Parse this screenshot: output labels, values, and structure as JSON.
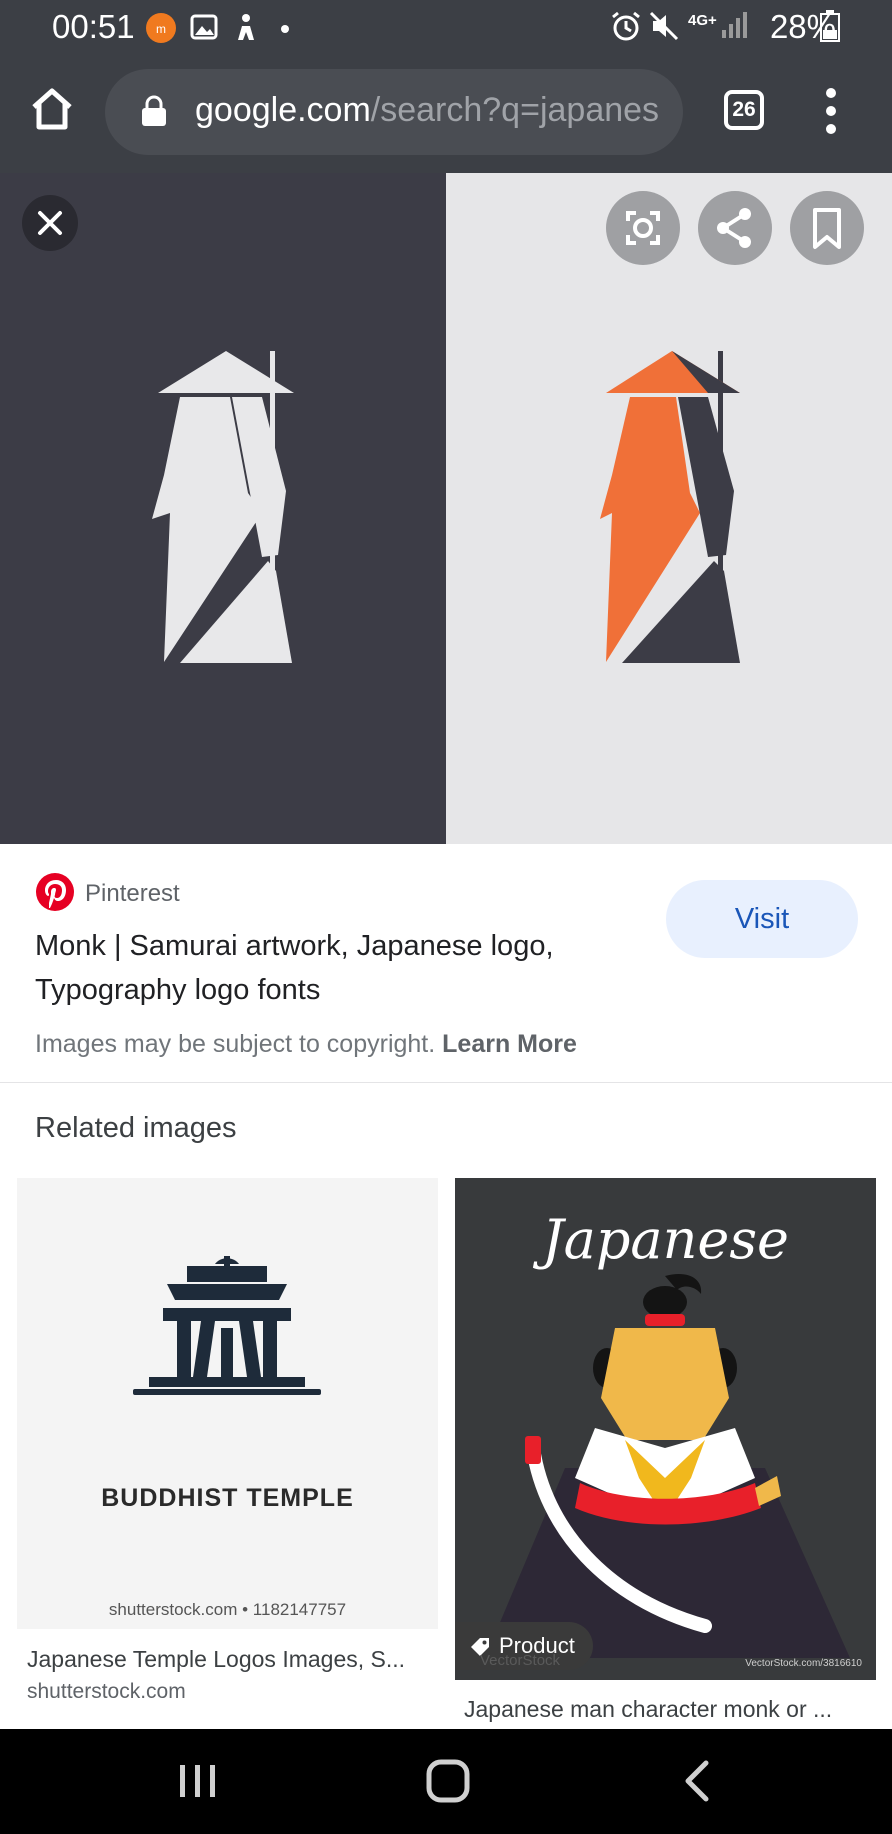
{
  "status_bar": {
    "time": "00:51",
    "network": "4G+",
    "battery_percent": "28%",
    "icons": [
      "app-notification-icon",
      "gallery-icon",
      "accessibility-icon",
      "dot-icon",
      "alarm-icon",
      "mute-icon",
      "signal-icon",
      "battery-icon"
    ]
  },
  "browser": {
    "url_domain": "google.com",
    "url_path": "/search?q=japanes",
    "tab_count": "26"
  },
  "result": {
    "source_name": "Pinterest",
    "visit_label": "Visit",
    "title": "Monk | Samurai artwork, Japanese logo, Typography logo fonts",
    "copyright_text": "Images may be subject to copyright.",
    "learn_more_label": "Learn More",
    "colors": {
      "accent_orange": "#f07038",
      "dark_panel": "#3c3c46",
      "light_panel": "#e6e6e8"
    }
  },
  "related": {
    "heading": "Related images",
    "items": [
      {
        "image_text": "BUDDHIST TEMPLE",
        "watermark": "shutterstock.com • 1182147757",
        "caption": "Japanese Temple Logos Images, S...",
        "domain": "shutterstock.com"
      },
      {
        "image_text": "Japanese",
        "chip_label": "Product",
        "watermark": "VectorStock",
        "watermark_small": "VectorStock.com/3816610",
        "caption": "Japanese man character monk or ..."
      }
    ]
  }
}
